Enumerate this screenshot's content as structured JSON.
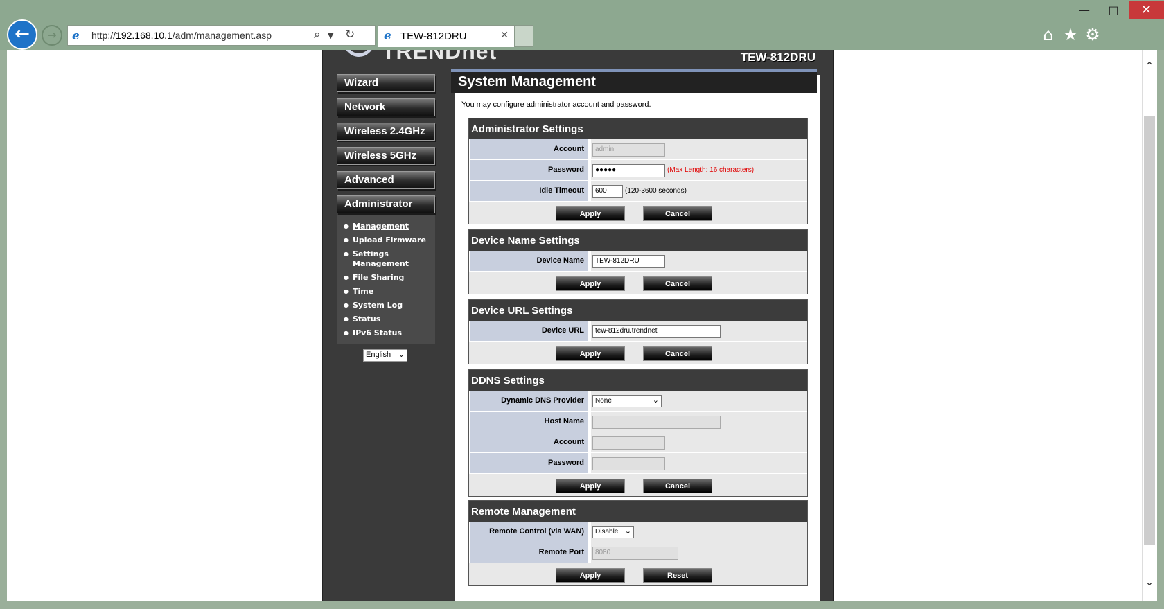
{
  "browser": {
    "url_prefix": "http://",
    "url_host": "192.168.10.1",
    "url_path": "/adm/management.asp",
    "tab_title": "TEW-812DRU",
    "window_controls": [
      "minimize",
      "maximize",
      "close"
    ],
    "icons": [
      "back-icon",
      "forward-icon",
      "ie-icon",
      "search-icon",
      "refresh-icon",
      "home-icon",
      "favorites-icon",
      "gear-icon"
    ]
  },
  "header": {
    "brand": "TRENDnet",
    "model": "TEW-812DRU"
  },
  "sidebar": {
    "menu": [
      {
        "label": "Wizard"
      },
      {
        "label": "Network"
      },
      {
        "label": "Wireless 2.4GHz"
      },
      {
        "label": "Wireless 5GHz"
      },
      {
        "label": "Advanced"
      },
      {
        "label": "Administrator"
      }
    ],
    "submenu": [
      {
        "label": "Management"
      },
      {
        "label": "Upload Firmware"
      },
      {
        "label": "Settings Management"
      },
      {
        "label": "File Sharing"
      },
      {
        "label": "Time"
      },
      {
        "label": "System Log"
      },
      {
        "label": "Status"
      },
      {
        "label": "IPv6 Status"
      }
    ],
    "language": "English"
  },
  "main": {
    "title": "System Management",
    "intro": "You may configure administrator account and password.",
    "admin": {
      "title": "Administrator Settings",
      "account_label": "Account",
      "account_value": "admin",
      "password_label": "Password",
      "password_value": "●●●●●",
      "password_note": "(Max Length: 16 characters)",
      "idle_label": "Idle Timeout",
      "idle_value": "600",
      "idle_note": "(120-3600 seconds)",
      "apply": "Apply",
      "cancel": "Cancel"
    },
    "device_name": {
      "title": "Device Name Settings",
      "label": "Device Name",
      "value": "TEW-812DRU",
      "apply": "Apply",
      "cancel": "Cancel"
    },
    "device_url": {
      "title": "Device URL Settings",
      "label": "Device URL",
      "value": "tew-812dru.trendnet",
      "apply": "Apply",
      "cancel": "Cancel"
    },
    "ddns": {
      "title": "DDNS Settings",
      "provider_label": "Dynamic DNS Provider",
      "provider_value": "None",
      "host_label": "Host Name",
      "account_label": "Account",
      "password_label": "Password",
      "apply": "Apply",
      "cancel": "Cancel"
    },
    "remote": {
      "title": "Remote Management",
      "control_label": "Remote Control (via WAN)",
      "control_value": "Disable",
      "port_label": "Remote Port",
      "port_value": "8080",
      "apply": "Apply",
      "reset": "Reset"
    }
  }
}
